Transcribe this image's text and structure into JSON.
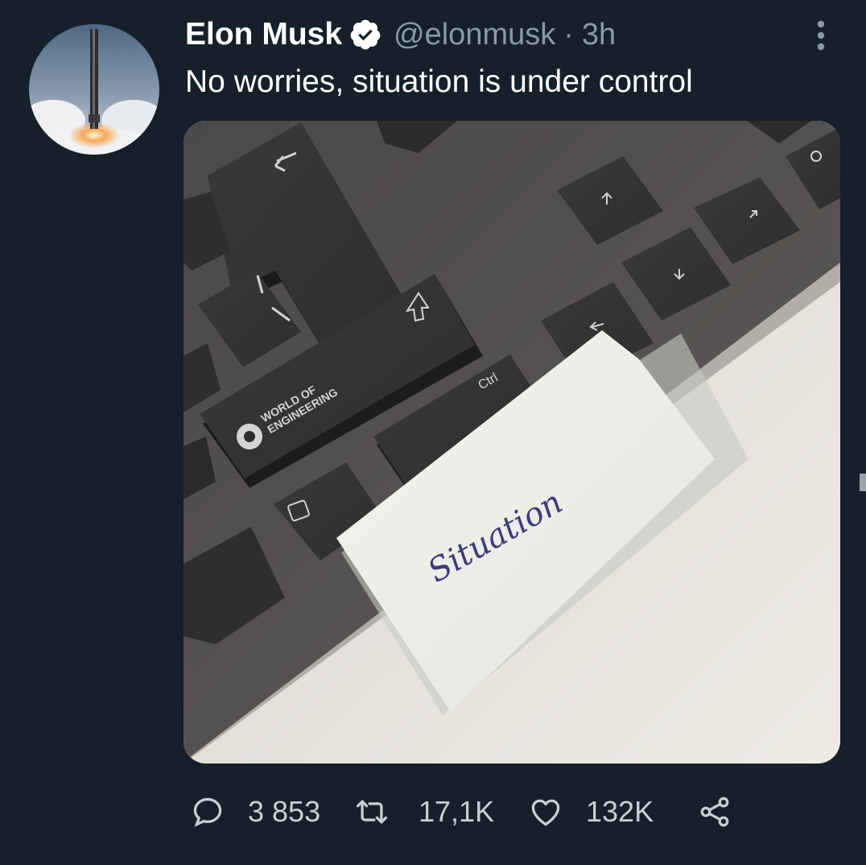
{
  "tweet": {
    "author_name": "Elon Musk",
    "handle": "@elonmusk",
    "separator": "·",
    "time": "3h",
    "text": "No worries, situation is under control",
    "verified": true
  },
  "media": {
    "key_labels": {
      "ctrl": "Ctrl",
      "note": "Situation"
    }
  },
  "actions": {
    "reply_count": "3 853",
    "retweet_count": "17,1K",
    "like_count": "132K"
  },
  "icons": {
    "verified": "verified-badge-icon",
    "more": "more-vertical-icon",
    "reply": "reply-icon",
    "retweet": "retweet-icon",
    "like": "heart-icon",
    "share": "share-icon"
  },
  "colors": {
    "background": "#15202b",
    "secondary_text": "#8b98a5",
    "primary_text": "#ffffff"
  }
}
